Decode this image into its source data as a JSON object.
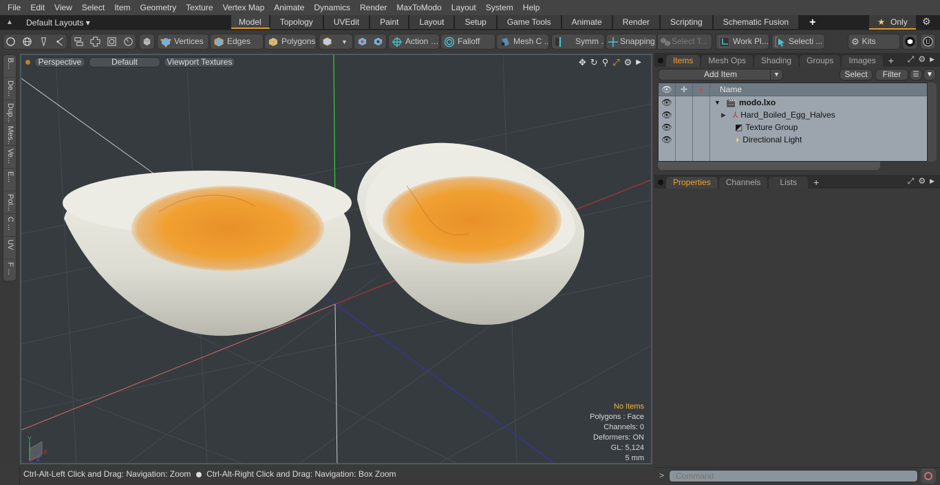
{
  "menubar": {
    "items": [
      "File",
      "Edit",
      "View",
      "Select",
      "Item",
      "Geometry",
      "Texture",
      "Vertex Map",
      "Animate",
      "Dynamics",
      "Render",
      "MaxToModo",
      "Layout",
      "System",
      "Help"
    ]
  },
  "layoutbar": {
    "layout_selector": "Default Layouts",
    "tabs": [
      {
        "label": "Model",
        "active": true
      },
      {
        "label": "Topology"
      },
      {
        "label": "UVEdit"
      },
      {
        "label": "Paint"
      },
      {
        "label": "Layout"
      },
      {
        "label": "Setup"
      },
      {
        "label": "Game Tools"
      },
      {
        "label": "Animate"
      },
      {
        "label": "Render"
      },
      {
        "label": "Scripting"
      },
      {
        "label": "Schematic Fusion"
      }
    ],
    "only_label": "Only"
  },
  "toolbar": {
    "vertices": "Vertices",
    "edges": "Edges",
    "polygons": "Polygons",
    "action": "Action",
    "falloff": "Falloff",
    "mesh_constraints": "Mesh C ...",
    "symmetry": "Symm ...",
    "snapping": "Snapping",
    "select_through": "Select T...",
    "work_plane": "Work Pl...",
    "selection": "Selecti ...",
    "kits": "Kits"
  },
  "leftstrip": {
    "tabs": [
      "B...",
      "De...",
      "Dup...",
      "Mes...",
      "Ve...",
      "E...",
      "Pol...",
      "C ...",
      "UV",
      "F ..."
    ]
  },
  "viewport": {
    "view_mode": "Perspective",
    "shading": "Default",
    "texture_mode": "Viewport Textures",
    "info": {
      "selection": "No Items",
      "polygons": "Polygons : Face",
      "channels": "Channels: 0",
      "deformers": "Deformers: ON",
      "gl": "GL: 5,124",
      "scale": "5 mm"
    },
    "axis_labels": {
      "x": "X",
      "y": "Y",
      "z": "Z"
    }
  },
  "statusbar": {
    "hint_left": "Ctrl-Alt-Left Click and Drag: Navigation: Zoom",
    "hint_right": "Ctrl-Alt-Right Click and Drag: Navigation: Box Zoom"
  },
  "items_panel": {
    "tabs": [
      {
        "label": "Items",
        "active": true
      },
      {
        "label": "Mesh Ops"
      },
      {
        "label": "Shading"
      },
      {
        "label": "Groups"
      },
      {
        "label": "Images"
      }
    ],
    "add_item": "Add Item",
    "select": "Select",
    "filter": "Filter",
    "column_name": "Name",
    "tree": [
      {
        "label": "modo.lxo",
        "icon": "scene-icon",
        "bold": true,
        "expanded": true
      },
      {
        "label": "Hard_Boiled_Egg_Halves",
        "icon": "mesh-locator-icon",
        "collapsed": true
      },
      {
        "label": "Texture Group",
        "icon": "texture-group-icon"
      },
      {
        "label": "Directional Light",
        "icon": "directional-light-icon"
      }
    ]
  },
  "properties_panel": {
    "tabs": [
      {
        "label": "Properties",
        "active": true
      },
      {
        "label": "Channels"
      },
      {
        "label": "Lists"
      }
    ]
  },
  "command": {
    "placeholder": "Command",
    "prompt": ">"
  },
  "colors": {
    "accent": "#e39a2a",
    "viewport_bg": "#363b40",
    "x_axis": "#c83232",
    "y_axis": "#32c832",
    "z_axis": "#3232c8"
  }
}
